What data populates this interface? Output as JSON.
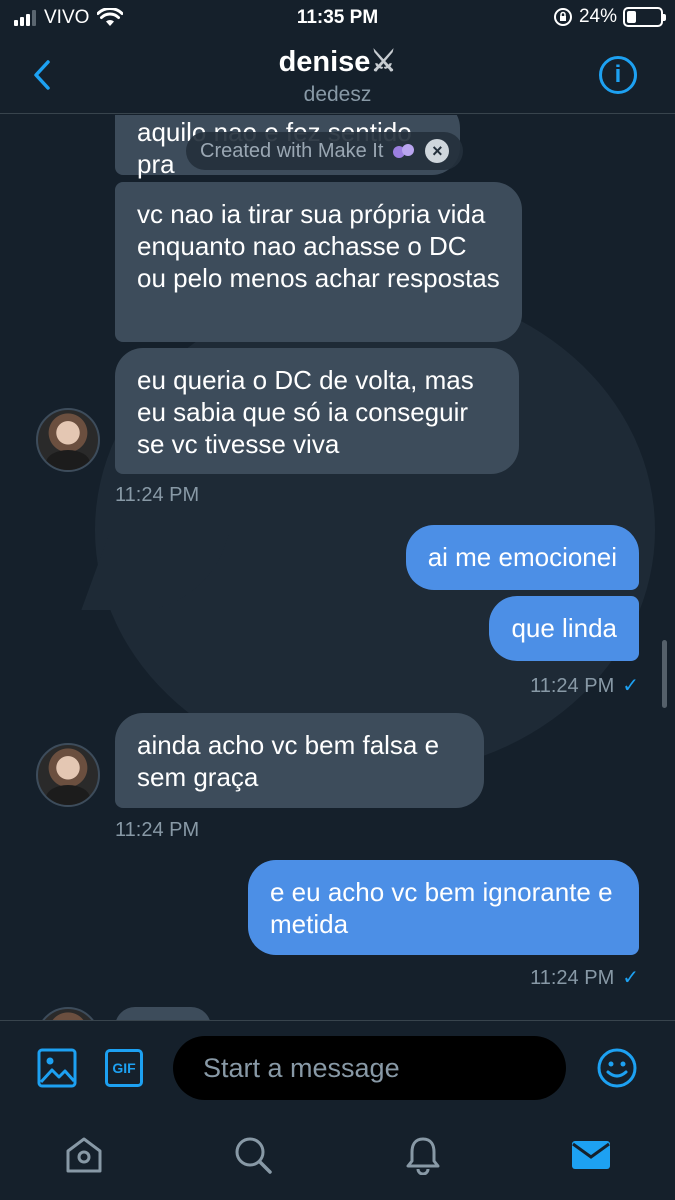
{
  "status_bar": {
    "carrier": "VIVO",
    "time": "11:35 PM",
    "battery": "24%"
  },
  "header": {
    "name": "denise",
    "name_emoji": "⚔",
    "handle": "dedesz"
  },
  "watermark": {
    "text": "Created with Make It"
  },
  "messages": [
    {
      "side": "received",
      "text": "aquilo nao e fez sentido pra"
    },
    {
      "side": "received",
      "text": "vc nao ia tirar sua própria vida enquanto nao achasse o DC ou pelo menos achar respostas"
    },
    {
      "side": "received",
      "text": "eu queria o DC de volta, mas eu sabia que só ia conseguir se vc tivesse viva"
    },
    {
      "side": "received_time",
      "text": "11:24 PM"
    },
    {
      "side": "sent",
      "text": "ai me emocionei"
    },
    {
      "side": "sent",
      "text": "que linda"
    },
    {
      "side": "sent_time",
      "text": "11:24 PM",
      "check": "✓"
    },
    {
      "side": "received",
      "text": "ainda acho vc bem falsa e sem graça"
    },
    {
      "side": "received_time",
      "text": "11:24 PM"
    },
    {
      "side": "sent",
      "text": "e eu acho vc bem ignorante e metida"
    },
    {
      "side": "sent_time",
      "text": "11:24 PM",
      "check": "✓"
    }
  ],
  "composer": {
    "placeholder": "Start a message",
    "gif_label": "GIF"
  },
  "colors": {
    "accent": "#1da1f2",
    "sent_bubble": "#4c8fe6",
    "received_bubble": "#3d4c5b",
    "background": "#15202b"
  },
  "icons": [
    "back-arrow-icon",
    "info-icon",
    "image-icon",
    "gif-icon",
    "emoji-icon",
    "home-icon",
    "search-icon",
    "bell-icon",
    "mail-icon"
  ]
}
